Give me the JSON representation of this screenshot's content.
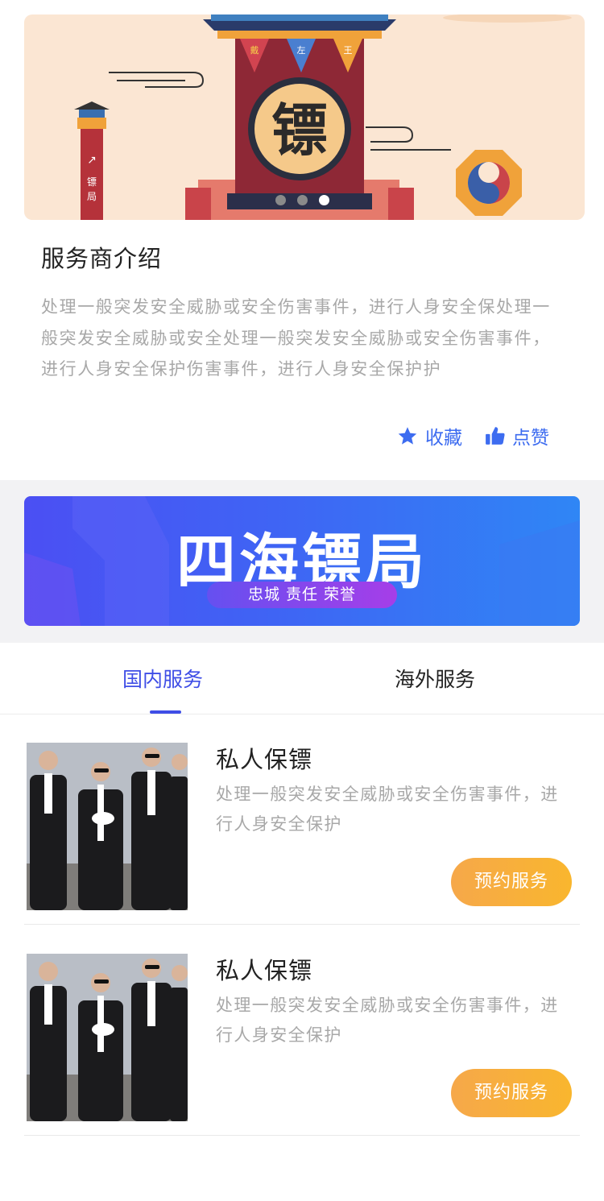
{
  "banner": {
    "sign_text": "镖",
    "flag_texts": [
      "戴",
      "左",
      "王"
    ],
    "pillar_text": "镖局",
    "slide_count": 3,
    "active_slide": 3
  },
  "intro": {
    "title": "服务商介绍",
    "text": "处理一般突发安全威胁或安全伤害事件，进行人身安全保处理一般突发安全威胁或安全处理一般突发安全威胁或安全伤害事件，进行人身安全保护伤害事件，进行人身安全保护护"
  },
  "actions": {
    "favorite_label": "收藏",
    "like_label": "点赞"
  },
  "promo": {
    "title": "四海镖局",
    "slogan": "忠城 责任 荣誉"
  },
  "tabs": [
    {
      "label": "国内服务",
      "active": true
    },
    {
      "label": "海外服务",
      "active": false
    }
  ],
  "services": [
    {
      "title": "私人保镖",
      "description": "处理一般突发安全威胁或安全伤害事件，进行人身安全保护",
      "button_label": "预约服务"
    },
    {
      "title": "私人保镖",
      "description": "处理一般突发安全威胁或安全伤害事件，进行人身安全保护",
      "button_label": "预约服务"
    }
  ],
  "colors": {
    "accent_blue": "#3f4ee6",
    "action_blue": "#3d6cf0",
    "button_orange": "#f7ad3f",
    "muted_text": "#a8a8a8"
  }
}
